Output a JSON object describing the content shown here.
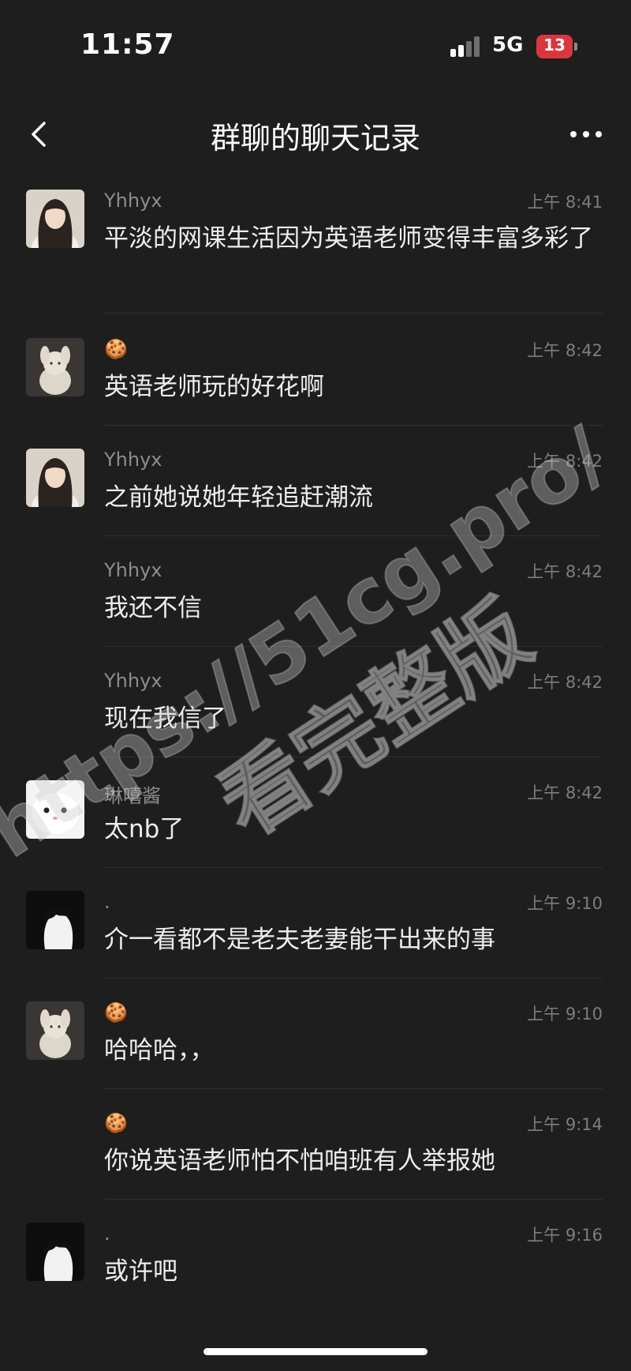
{
  "status_bar": {
    "time": "11:57",
    "network": "5G",
    "battery": "13"
  },
  "nav": {
    "title": "群聊的聊天记录",
    "back_icon": "chevron-left-icon",
    "more_icon": "more-dots-icon"
  },
  "messages": [
    {
      "sender": "Yhhyx",
      "time": "上午 8:41",
      "text": "平淡的网课生活因为英语老师变得丰富多彩了",
      "avatar": "girl-portrait"
    },
    {
      "sender": "🍪",
      "time": "上午 8:42",
      "text": "英语老师玩的好花啊",
      "avatar": "plush-bunny"
    },
    {
      "sender": "Yhhyx",
      "time": "上午 8:42",
      "text": "之前她说她年轻追赶潮流",
      "avatar": "girl-portrait"
    },
    {
      "sender": "Yhhyx",
      "time": "上午 8:42",
      "text": "我还不信",
      "avatar": ""
    },
    {
      "sender": "Yhhyx",
      "time": "上午 8:42",
      "text": "现在我信了",
      "avatar": ""
    },
    {
      "sender": "琳嘻酱",
      "time": "上午 8:42",
      "text": "太nb了",
      "avatar": "white-cat"
    },
    {
      "sender": ".",
      "time": "上午 9:10",
      "text": "介一看都不是老夫老妻能干出来的事",
      "avatar": "anime-boy-bw"
    },
    {
      "sender": "🍪",
      "time": "上午 9:10",
      "text": "哈哈哈，，",
      "avatar": "plush-bunny"
    },
    {
      "sender": "🍪",
      "time": "上午 9:14",
      "text": "你说英语老师怕不怕咱班有人举报她",
      "avatar": ""
    },
    {
      "sender": ".",
      "time": "上午 9:16",
      "text": "或许吧",
      "avatar": "anime-boy-bw"
    }
  ],
  "watermark": {
    "line1": "https://51cg.pro/",
    "line2": "看完整版"
  },
  "colors": {
    "background": "#1e1e1e",
    "battery": "#d9363e"
  }
}
